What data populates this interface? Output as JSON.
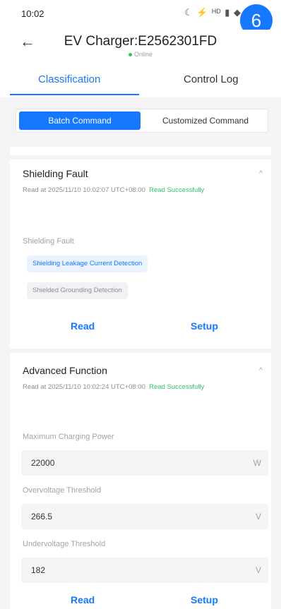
{
  "status_bar": {
    "time": "10:02",
    "icons": "☾ ⚡ ᴴᴰ ▮ ◆",
    "badge": "6"
  },
  "header": {
    "back_glyph": "←",
    "title": "EV Charger:E2562301FD",
    "status": "Online"
  },
  "tabs": [
    {
      "label": "Classification",
      "active": true
    },
    {
      "label": "Control Log",
      "active": false
    }
  ],
  "segment": {
    "batch": "Batch Command",
    "custom": "Customized Command"
  },
  "shielding": {
    "title": "Shielding Fault",
    "chevron": "^",
    "read_at": "Read at 2025/11/10 10:02:07 UTC+08:00",
    "read_status": "Read Successfully",
    "section_label": "Shielding Fault",
    "options": [
      {
        "label": "Shielding Leakage Current Detection",
        "selected": true
      },
      {
        "label": "Shielded Grounding Detection",
        "selected": false
      }
    ],
    "read_btn": "Read",
    "setup_btn": "Setup"
  },
  "advanced": {
    "title": "Advanced Function",
    "chevron": "^",
    "read_at": "Read at 2025/11/10 10:02:24 UTC+08:00",
    "read_status": "Read Successfully",
    "fields": [
      {
        "label": "Maximum Charging Power",
        "value": "22000",
        "unit": "W"
      },
      {
        "label": "Overvoltage Threshold",
        "value": "266.5",
        "unit": "V"
      },
      {
        "label": "Undervoltage Threshold",
        "value": "182",
        "unit": "V"
      }
    ],
    "read_btn": "Read",
    "setup_btn": "Setup"
  },
  "colors": {
    "accent": "#1677ff",
    "success": "#32c36c",
    "background": "#f4f4f6"
  }
}
